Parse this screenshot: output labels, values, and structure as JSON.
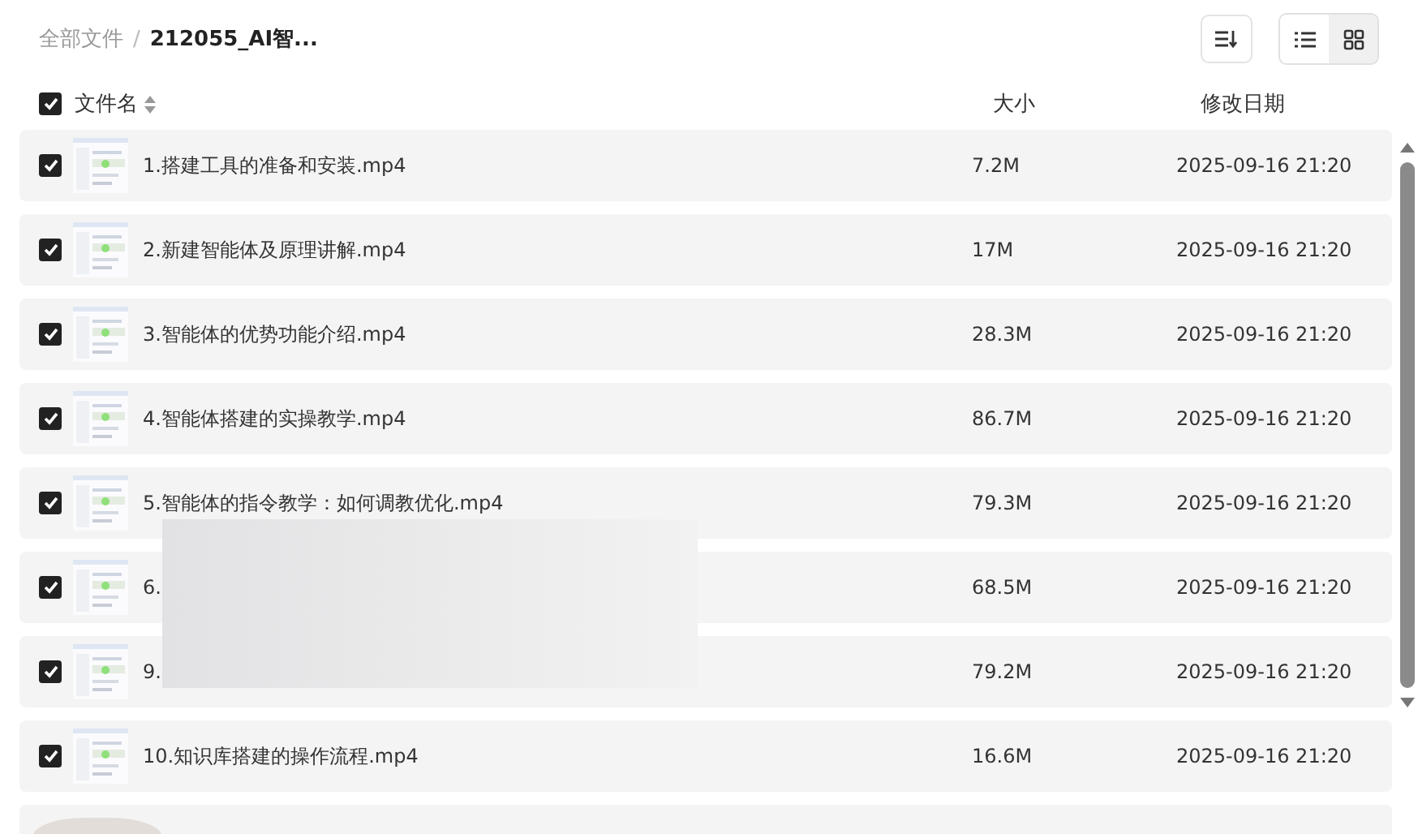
{
  "breadcrumb": {
    "root": "全部文件",
    "separator": "/",
    "current": "212055_AI智..."
  },
  "toolbar": {
    "views": [
      {
        "kind": "list",
        "selected": true
      },
      {
        "kind": "grid",
        "selected": false
      }
    ]
  },
  "table": {
    "select_all": {
      "checked": true
    },
    "columns": [
      {
        "label": "文件名",
        "sortable": true
      },
      {
        "label": "大小",
        "sortable": false
      },
      {
        "label": "修改日期",
        "sortable": false
      }
    ],
    "rows": [
      {
        "checked": true,
        "name": "1.搭建工具的准备和安装.mp4",
        "size": "7.2M",
        "date": "2025-09-16 21:20"
      },
      {
        "checked": true,
        "name": "2.新建智能体及原理讲解.mp4",
        "size": "17M",
        "date": "2025-09-16 21:20"
      },
      {
        "checked": true,
        "name": "3.智能体的优势功能介绍.mp4",
        "size": "28.3M",
        "date": "2025-09-16 21:20"
      },
      {
        "checked": true,
        "name": "4.智能体搭建的实操教学.mp4",
        "size": "86.7M",
        "date": "2025-09-16 21:20"
      },
      {
        "checked": true,
        "name": "5.智能体的指令教学：如何调教优化.mp4",
        "size": "79.3M",
        "date": "2025-09-16 21:20"
      },
      {
        "checked": true,
        "name": "6.",
        "size": "68.5M",
        "date": "2025-09-16 21:20"
      },
      {
        "checked": true,
        "name": "9.",
        "size": "79.2M",
        "date": "2025-09-16 21:20"
      },
      {
        "checked": true,
        "name": "10.知识库搭建的操作流程.mp4",
        "size": "16.6M",
        "date": "2025-09-16 21:20"
      }
    ]
  }
}
